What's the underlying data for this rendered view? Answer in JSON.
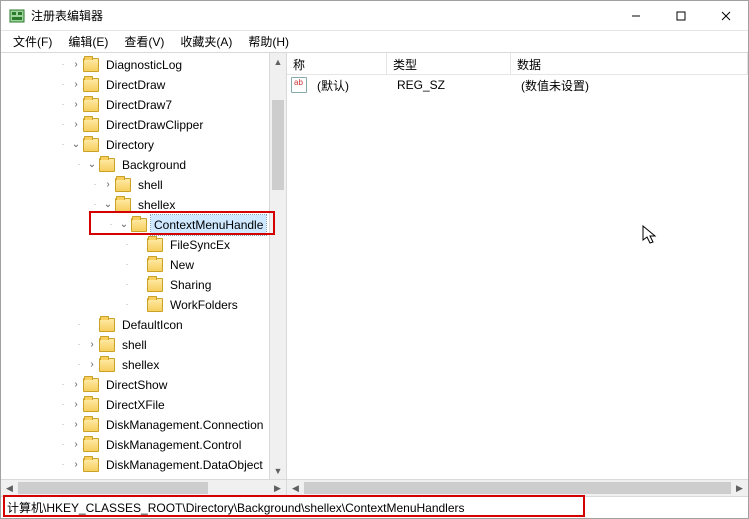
{
  "window": {
    "title": "注册表编辑器"
  },
  "menu": {
    "file": "文件(F)",
    "edit": "编辑(E)",
    "view": "查看(V)",
    "favorites": "收藏夹(A)",
    "help": "帮助(H)"
  },
  "tree": {
    "items": [
      {
        "indent": 3,
        "tw": "closed",
        "label": "DiagnosticLog"
      },
      {
        "indent": 3,
        "tw": "closed",
        "label": "DirectDraw"
      },
      {
        "indent": 3,
        "tw": "closed",
        "label": "DirectDraw7"
      },
      {
        "indent": 3,
        "tw": "closed",
        "label": "DirectDrawClipper"
      },
      {
        "indent": 3,
        "tw": "open",
        "label": "Directory"
      },
      {
        "indent": 4,
        "tw": "open",
        "label": "Background"
      },
      {
        "indent": 5,
        "tw": "closed",
        "label": "shell"
      },
      {
        "indent": 5,
        "tw": "open",
        "label": "shellex"
      },
      {
        "indent": 6,
        "tw": "open",
        "label": "ContextMenuHandle",
        "selected": true
      },
      {
        "indent": 7,
        "tw": "none",
        "label": "FileSyncEx"
      },
      {
        "indent": 7,
        "tw": "none",
        "label": "New"
      },
      {
        "indent": 7,
        "tw": "none",
        "label": "Sharing"
      },
      {
        "indent": 7,
        "tw": "none",
        "label": "WorkFolders"
      },
      {
        "indent": 4,
        "tw": "none",
        "label": "DefaultIcon"
      },
      {
        "indent": 4,
        "tw": "closed",
        "label": "shell"
      },
      {
        "indent": 4,
        "tw": "closed",
        "label": "shellex"
      },
      {
        "indent": 3,
        "tw": "closed",
        "label": "DirectShow"
      },
      {
        "indent": 3,
        "tw": "closed",
        "label": "DirectXFile"
      },
      {
        "indent": 3,
        "tw": "closed",
        "label": "DiskManagement.Connection"
      },
      {
        "indent": 3,
        "tw": "closed",
        "label": "DiskManagement.Control"
      },
      {
        "indent": 3,
        "tw": "closed",
        "label": "DiskManagement.DataObject"
      }
    ]
  },
  "list": {
    "headers": {
      "name": "称",
      "type": "类型",
      "data": "数据"
    },
    "rows": [
      {
        "name": "(默认)",
        "type": "REG_SZ",
        "data": "(数值未设置)"
      }
    ]
  },
  "status": {
    "path": "计算机\\HKEY_CLASSES_ROOT\\Directory\\Background\\shellex\\ContextMenuHandlers"
  }
}
